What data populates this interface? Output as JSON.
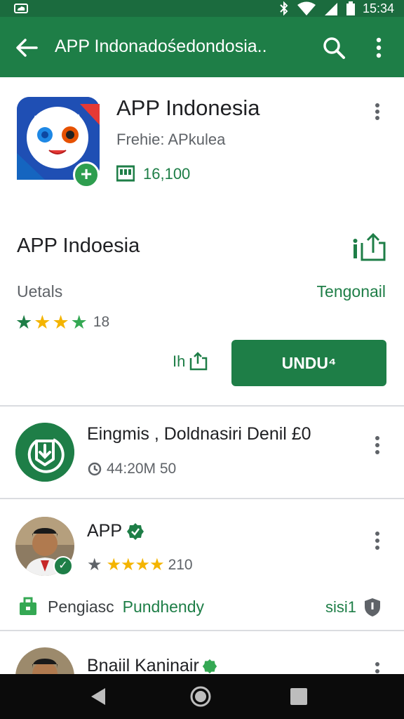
{
  "status_bar": {
    "time": "15:34",
    "icons": [
      "cloud-icon",
      "bluetooth-icon",
      "wifi-icon",
      "signal-icon",
      "battery-icon"
    ]
  },
  "app_bar": {
    "title": "APP Indonadośedondosia..",
    "icons": [
      "back-arrow-icon",
      "search-icon",
      "more-vert-icon"
    ]
  },
  "app_header": {
    "name": "APP Indonesia",
    "developer": "Frehie: APkulea",
    "downloads": "16,100",
    "icons": [
      "app-icon",
      "plus-badge-icon",
      "rating-tile-icon",
      "more-vert-icon"
    ]
  },
  "detail_section": {
    "title": "APP Indoesia",
    "details_label": "Uetals",
    "details_link": "Tengonail",
    "rating_count": "18",
    "stars": [
      "#1e7e47",
      "#f4b400",
      "#f4b400",
      "#34a853"
    ],
    "wish_label": "Ih",
    "install_label": "UNDU⁴",
    "icons": [
      "share-icon",
      "wishlist-icon"
    ]
  },
  "rows": [
    {
      "title": "Eingmis , Doldnasiri Denil £0",
      "meta": "44:20M 50",
      "icon": "download-shield-icon"
    },
    {
      "title": "APP",
      "rating": "210",
      "verified": true,
      "icon": "avatar"
    },
    {
      "title": "Bnaiil Kaninair",
      "verified": true,
      "icon": "avatar"
    }
  ],
  "feature": {
    "label_plain": "Pengiasc",
    "label_link": "Pundhendy",
    "right_text": "sisi1",
    "icons": [
      "briefcase-icon",
      "shield-icon"
    ]
  },
  "colors": {
    "primary": "#1e7e47",
    "status_bar": "#1b6b3e",
    "star_gold": "#f4b400",
    "nav_bar": "#0b0b0b"
  },
  "nav_bar": {
    "icons": [
      "back-triangle-icon",
      "home-circle-icon",
      "recents-square-icon"
    ]
  }
}
